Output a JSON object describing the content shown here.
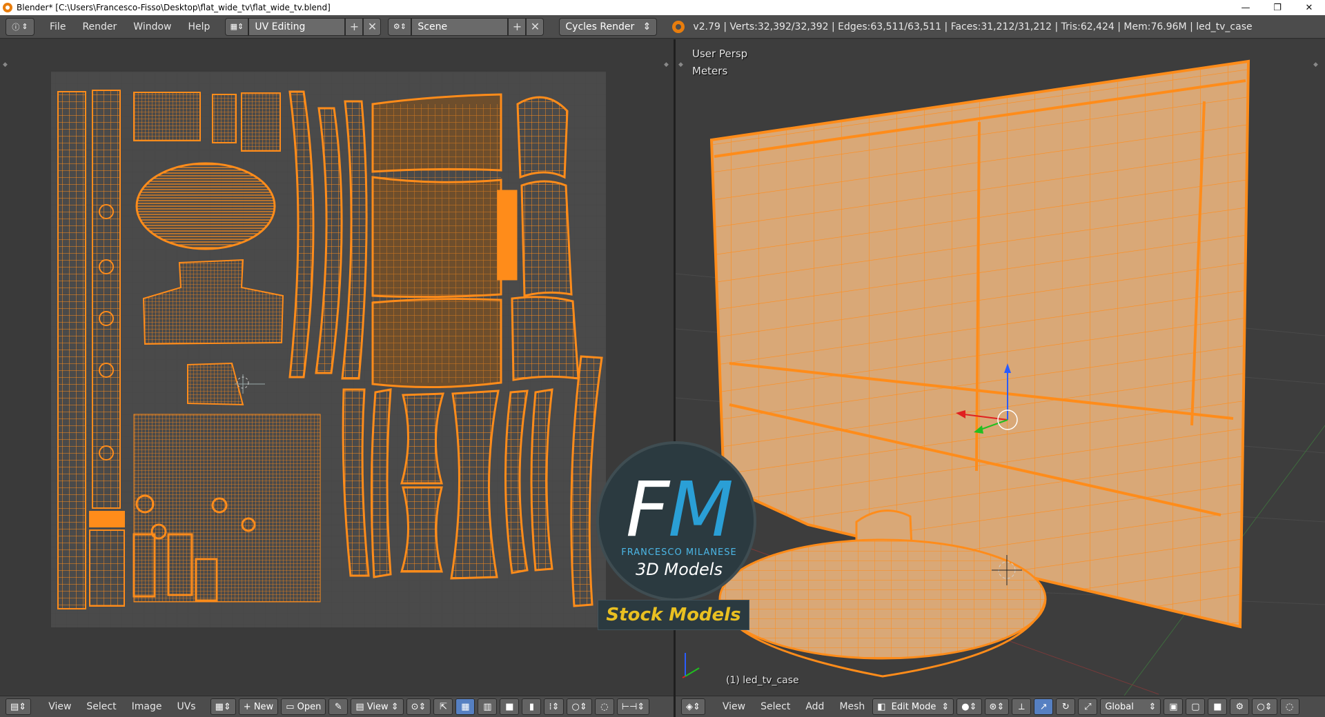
{
  "window": {
    "title": "Blender* [C:\\Users\\Francesco-Fisso\\Desktop\\flat_wide_tv\\flat_wide_tv.blend]",
    "minimize": "—",
    "restore": "❐",
    "close": "✕"
  },
  "infobar": {
    "menus": [
      "File",
      "Render",
      "Window",
      "Help"
    ],
    "screen_layout": "UV Editing",
    "scene": "Scene",
    "render_engine": "Cycles Render",
    "stats": "v2.79 | Verts:32,392/32,392 | Edges:63,511/63,511 | Faces:31,212/31,212 | Tris:62,424 | Mem:76.96M | led_tv_case"
  },
  "viewport": {
    "view_name": "User Persp",
    "units": "Meters",
    "object_label": "(1) led_tv_case"
  },
  "uv_header": {
    "menus": [
      "View",
      "Select",
      "Image",
      "UVs"
    ],
    "new_label": "New",
    "open_label": "Open",
    "view_label": "View"
  },
  "v3d_header": {
    "menus": [
      "View",
      "Select",
      "Add",
      "Mesh"
    ],
    "mode": "Edit Mode",
    "orientation": "Global"
  },
  "watermark": {
    "initial_f": "F",
    "initial_m": "M",
    "name": "FRANCESCO MILANESE",
    "subtitle": "3D Models",
    "banner": "Stock Models"
  },
  "colors": {
    "accent": "#e87d0d",
    "uv_wire": "#ff8c1a",
    "mesh_face": "#d9a877",
    "logo_blue": "#2a9fd6",
    "banner_yellow": "#e9c021"
  }
}
